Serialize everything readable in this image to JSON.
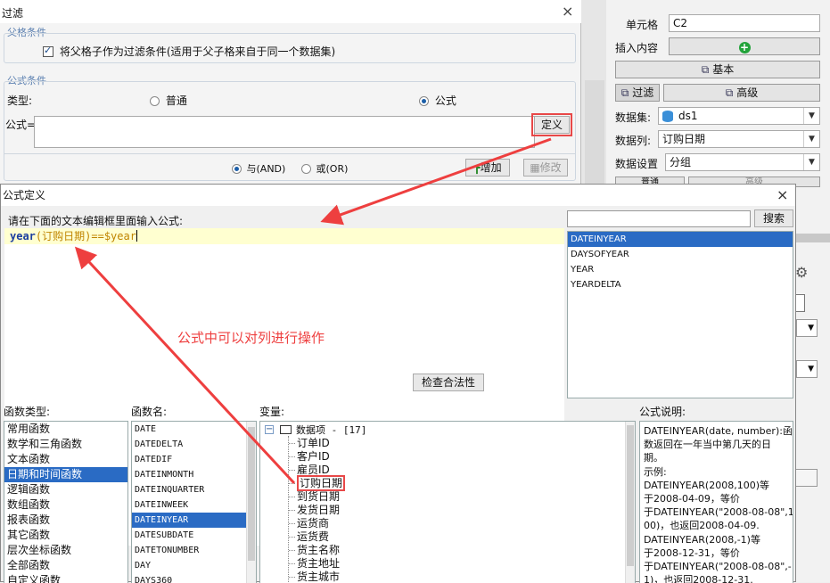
{
  "filter_window": {
    "title": "过滤",
    "close": "×",
    "parent_section": "父格条件",
    "parent_checkbox": "将父格子作为过滤条件(适用于父子格来自于同一个数据集)",
    "formula_section": "公式条件",
    "type_label": "类型:",
    "type_normal": "普通",
    "type_formula": "公式",
    "formula_label": "公式=",
    "define_button": "定义",
    "and_label": "与(AND)",
    "or_label": "或(OR)",
    "add_button": "增加",
    "modify_button": "修改"
  },
  "right_panel": {
    "cell_label": "单元格",
    "cell_value": "C2",
    "insert_label": "插入内容",
    "basic_button": "基本",
    "filter_button": "过滤",
    "advanced_button": "高级",
    "dataset_label": "数据集:",
    "dataset_value": "ds1",
    "column_label": "数据列:",
    "column_value": "订购日期",
    "setting_label": "数据设置",
    "setting_value": "分组",
    "partial_a": "普通",
    "partial_b": "高级"
  },
  "formula_dialog": {
    "title": "公式定义",
    "close": "×",
    "prompt": "请在下面的文本编辑框里面输入公式:",
    "formula_fn": "year",
    "formula_open": "(",
    "formula_col": "订购日期",
    "formula_rest": ")==$year",
    "annotation": "公式中可以对列进行操作",
    "search_placeholder": "",
    "search_button": "搜索",
    "search_results": [
      "DATEINYEAR",
      "DAYSOFYEAR",
      "YEAR",
      "YEARDELTA"
    ],
    "check_button": "检查合法性",
    "function_type_label": "函数类型:",
    "function_types": [
      "常用函数",
      "数学和三角函数",
      "文本函数",
      "日期和时间函数",
      "逻辑函数",
      "数组函数",
      "报表函数",
      "其它函数",
      "层次坐标函数",
      "全部函数",
      "自定义函数"
    ],
    "function_name_label": "函数名:",
    "function_names": [
      "DATE",
      "DATEDELTA",
      "DATEDIF",
      "DATEINMONTH",
      "DATEINQUARTER",
      "DATEINWEEK",
      "DATEINYEAR",
      "DATESUBDATE",
      "DATETONUMBER",
      "DAY",
      "DAYS360"
    ],
    "variable_label": "变量:",
    "variable_root": "数据项 - [17]",
    "variables": [
      "订单ID",
      "客户ID",
      "雇员ID",
      "订购日期",
      "到货日期",
      "发货日期",
      "运货商",
      "运货费",
      "货主名称",
      "货主地址",
      "货主城市"
    ],
    "description_label": "公式说明:",
    "description_lines": [
      "DATEINYEAR(date, number):函",
      "数返回在一年当中第几天的日",
      "期。",
      "示例:",
      "DATEINYEAR(2008,100)等",
      "于2008-04-09，等价",
      "于DATEINYEAR(\"2008-08-08\",1",
      "00)，也返回2008-04-09.",
      "DATEINYEAR(2008,-1)等",
      "于2008-12-31，等价",
      "于DATEINYEAR(\"2008-08-08\",-",
      "1)，也返回2008-12-31."
    ]
  },
  "colors": {
    "selection": "#2a6bc4",
    "annotation_red": "#ee3f3f",
    "formula_blue": "#1d3fa0"
  }
}
